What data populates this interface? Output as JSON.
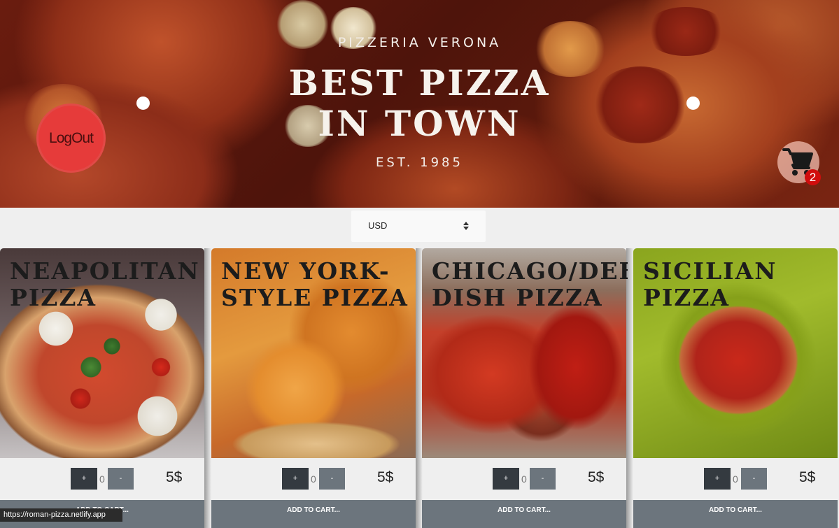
{
  "hero": {
    "brand": "PIZZERIA VERONA",
    "title_line1": "BEST PIZZA",
    "title_line2": "IN TOWN",
    "established": "EST. 1985"
  },
  "logout_label": "LogOut",
  "cart": {
    "count": "2",
    "icon": "shopping-cart-icon"
  },
  "currency": {
    "selected": "USD"
  },
  "products": [
    {
      "name": "NEAPOLITAN PIZZA",
      "qty": "0",
      "price": "5$",
      "plus": "+",
      "minus": "-",
      "add": "ADD TO CART..."
    },
    {
      "name": "NEW YORK-STYLE PIZZA",
      "qty": "0",
      "price": "5$",
      "plus": "+",
      "minus": "-",
      "add": "ADD TO CART..."
    },
    {
      "name": "CHICAGO/DEEP DISH PIZZA",
      "qty": "0",
      "price": "5$",
      "plus": "+",
      "minus": "-",
      "add": "ADD TO CART..."
    },
    {
      "name": "SICILIAN PIZZA",
      "qty": "0",
      "price": "5$",
      "plus": "+",
      "minus": "-",
      "add": "ADD TO CART..."
    }
  ],
  "status_url": "https://roman-pizza.netlify.app"
}
